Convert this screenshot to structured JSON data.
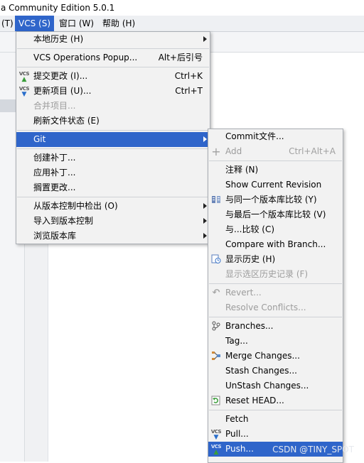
{
  "window": {
    "title_fragment": "a Community Edition 5.0.1"
  },
  "menubar": {
    "items": [
      {
        "label": "(T)"
      },
      {
        "label": "VCS (S)"
      },
      {
        "label": "窗口 (W)"
      },
      {
        "label": "帮助 (H)"
      }
    ]
  },
  "vcs_menu": {
    "local_history": "本地历史 (H)",
    "operations_popup": "VCS Operations Popup...",
    "operations_popup_sc": "Alt+后引号",
    "commit_changes": "提交更改 (I)...",
    "commit_changes_sc": "Ctrl+K",
    "update_project": "更新项目 (U)...",
    "update_project_sc": "Ctrl+T",
    "merge_project": "合并项目...",
    "refresh_status": "刷新文件状态 (E)",
    "git": "Git",
    "create_patch": "创建补丁...",
    "apply_patch": "应用补丁...",
    "shelve_changes": "搁置更改...",
    "checkout": "从版本控制中检出 (O)",
    "import": "导入到版本控制",
    "browse": "浏览版本库"
  },
  "git_menu": {
    "commit_file": "Commit文件...",
    "add": "Add",
    "add_sc": "Ctrl+Alt+A",
    "annotate": "注释 (N)",
    "show_current_revision": "Show Current Revision",
    "compare_same_revision": "与同一个版本库比较 (Y)",
    "compare_latest": "与最后一个版本库比较 (V)",
    "compare_with": "与...比较 (C)",
    "compare_branch": "Compare with Branch...",
    "show_history": "显示历史 (H)",
    "show_selection_history": "显示选区历史记录 (F)",
    "revert": "Revert...",
    "resolve_conflicts": "Resolve Conflicts...",
    "branches": "Branches...",
    "tag": "Tag...",
    "merge_changes": "Merge Changes...",
    "stash_changes": "Stash Changes...",
    "unstash_changes": "UnStash Changes...",
    "reset_head": "Reset HEAD...",
    "fetch": "Fetch",
    "pull": "Pull...",
    "push": "Push..."
  },
  "watermark": "CSDN @TINY_SPOT",
  "colors": {
    "selection": "#2f65ca",
    "menu_bg": "#f2f2f2",
    "menubar_bg": "#eef0f3"
  },
  "icons": {
    "vcs_commit": "vcs-commit-icon",
    "vcs_update": "vcs-update-icon",
    "add": "plus-icon",
    "compare": "compare-icon",
    "history": "history-icon",
    "revert": "undo-icon",
    "branches": "branch-icon",
    "merge": "merge-icon",
    "reset": "reset-icon"
  }
}
